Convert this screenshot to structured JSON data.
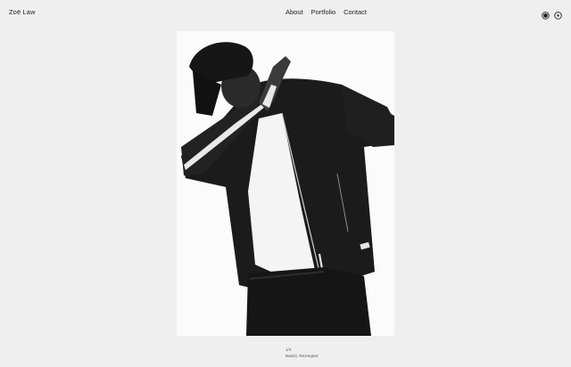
{
  "header": {
    "brand": "Zoë Law",
    "nav": [
      {
        "label": "About"
      },
      {
        "label": "Portfolio"
      },
      {
        "label": "Contact"
      }
    ],
    "social_icons": [
      "circle-filled-icon",
      "circle-dot-icon"
    ]
  },
  "photo": {
    "description_icon": "photo-portrait-man-dabbing"
  },
  "caption": {
    "counter": "1/4",
    "credit": "Bantzi, Rezneperr"
  }
}
